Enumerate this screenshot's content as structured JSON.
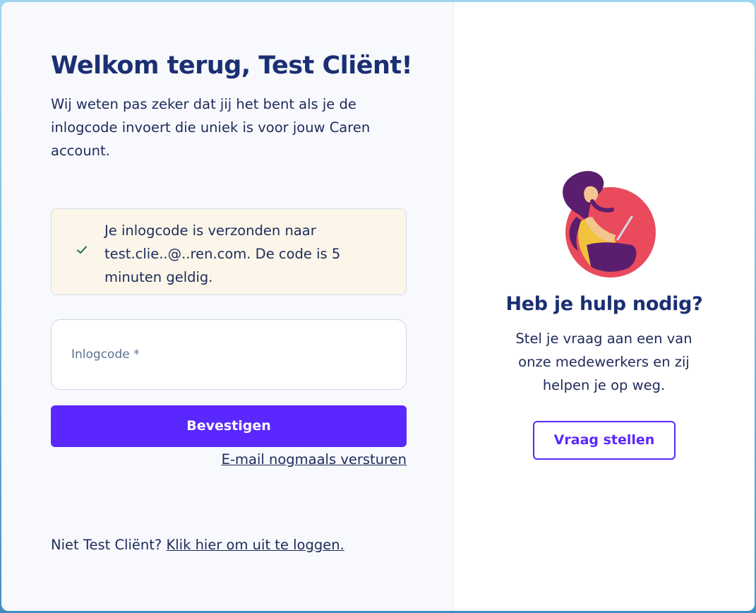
{
  "login": {
    "title": "Welkom terug, Test Cliënt!",
    "intro": "Wij weten pas zeker dat jij het bent als je de inlogcode invoert die uniek is voor jouw Caren account.",
    "notice": {
      "icon": "check-icon",
      "message": "Je inlogcode is verzonden naar test.clie..@..ren.com. De code is 5 minuten geldig."
    },
    "code_field": {
      "placeholder": "Inlogcode *",
      "value": ""
    },
    "confirm_label": "Bevestigen",
    "resend_label": "E-mail nogmaals versturen",
    "footer": {
      "prefix": "Niet Test Cliënt?",
      "logout_link": "Klik hier om uit te loggen."
    }
  },
  "help": {
    "illustration": "woman-with-laptop-illustration",
    "title": "Heb je hulp nodig?",
    "text": "Stel je vraag aan een van onze medewerkers en zij helpen je op weg.",
    "button_label": "Vraag stellen"
  },
  "colors": {
    "accent": "#5a28ff",
    "heading": "#1b2f73",
    "notice_bg": "#fbf6e9",
    "illustration_circle": "#e94b5c",
    "illustration_hair": "#5b1e6e"
  }
}
